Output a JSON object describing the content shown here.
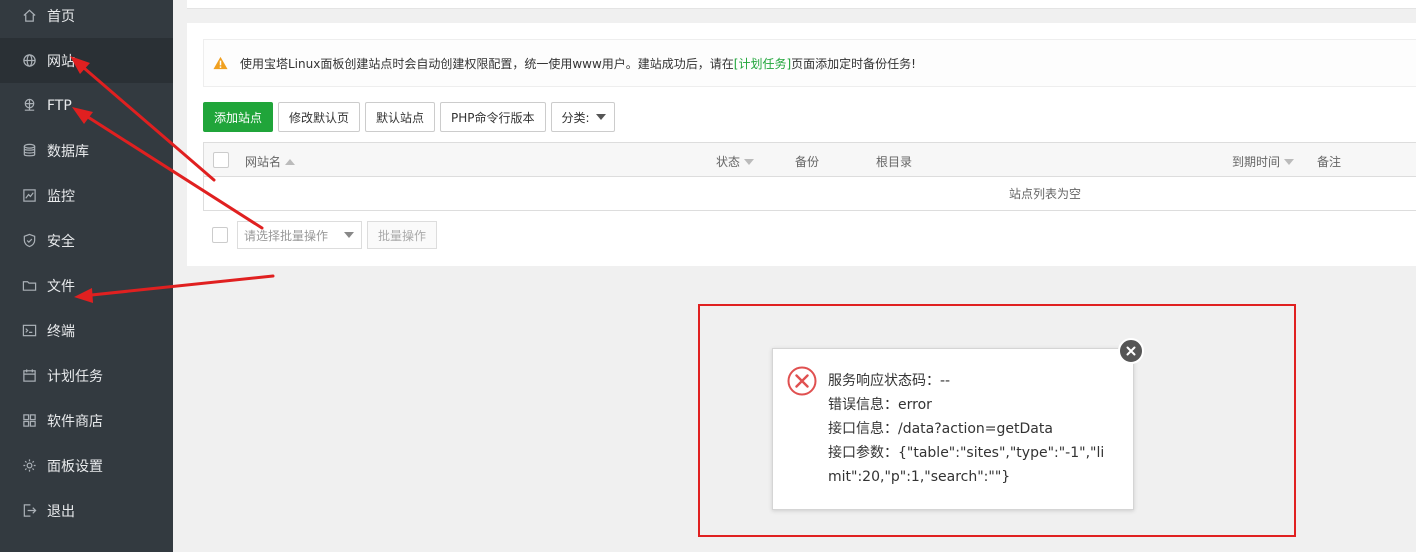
{
  "sidebar": {
    "items": [
      {
        "label": "首页",
        "icon": "home-icon"
      },
      {
        "label": "网站",
        "icon": "globe-icon"
      },
      {
        "label": "FTP",
        "icon": "ftp-icon"
      },
      {
        "label": "数据库",
        "icon": "database-icon"
      },
      {
        "label": "监控",
        "icon": "monitor-icon"
      },
      {
        "label": "安全",
        "icon": "shield-icon"
      },
      {
        "label": "文件",
        "icon": "folder-icon"
      },
      {
        "label": "终端",
        "icon": "terminal-icon"
      },
      {
        "label": "计划任务",
        "icon": "calendar-icon"
      },
      {
        "label": "软件商店",
        "icon": "apps-icon"
      },
      {
        "label": "面板设置",
        "icon": "gear-icon"
      },
      {
        "label": "退出",
        "icon": "logout-icon"
      }
    ]
  },
  "notice": {
    "text_before": "使用宝塔Linux面板创建站点时会自动创建权限配置，统一使用www用户。建站成功后，请在",
    "link": "[计划任务]",
    "text_after": "页面添加定时备份任务!"
  },
  "toolbar": {
    "add_site": "添加站点",
    "edit_default_page": "修改默认页",
    "default_site": "默认站点",
    "php_cli_version": "PHP命令行版本",
    "category": "分类:"
  },
  "table": {
    "columns": {
      "name": "网站名",
      "status": "状态",
      "backup": "备份",
      "root": "根目录",
      "expire": "到期时间",
      "remark": "备注"
    },
    "empty_text": "站点列表为空"
  },
  "batch": {
    "placeholder": "请选择批量操作",
    "button": "批量操作"
  },
  "error_dialog": {
    "status_line": "服务响应状态码：--",
    "error_line": "错误信息：error",
    "api_line": "接口信息：/data?action=getData",
    "params_line": "接口参数：{\"table\":\"sites\",\"type\":\"-1\",\"limit\":20,\"p\":1,\"search\":\"\"}"
  },
  "colors": {
    "sidebar_bg": "#333a40",
    "accent_green": "#20a53a",
    "annotation_red": "#e02020",
    "warning_orange": "#f0a020"
  }
}
